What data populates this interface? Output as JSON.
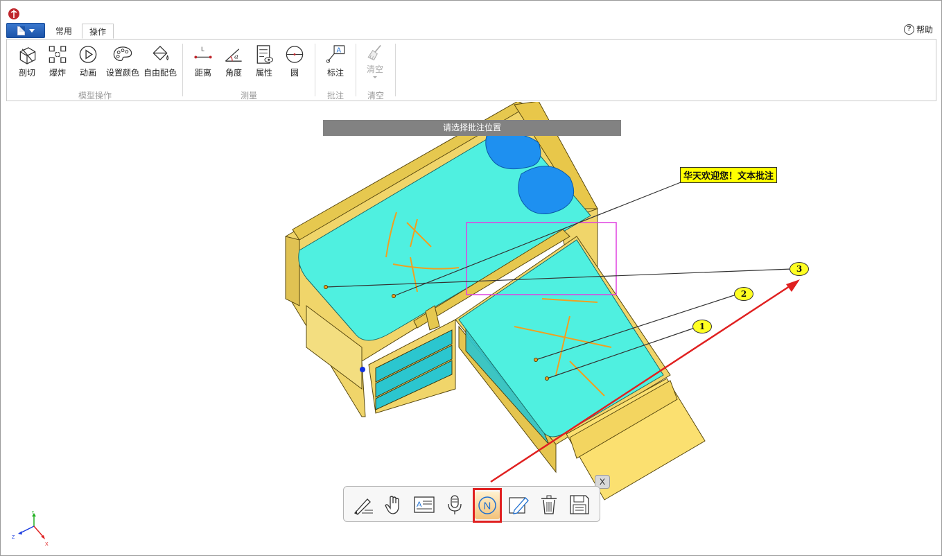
{
  "tabs": [
    {
      "label": "常用"
    },
    {
      "label": "操作"
    }
  ],
  "help": {
    "icon": "help-circle-icon",
    "label": "帮助",
    "glyph": "?"
  },
  "ribbon": {
    "groups": [
      {
        "label": "模型操作",
        "buttons": [
          {
            "label": "剖切",
            "icon": "section-cut-icon"
          },
          {
            "label": "爆炸",
            "icon": "explode-icon"
          },
          {
            "label": "动画",
            "icon": "animation-play-icon"
          },
          {
            "label": "设置颜色",
            "icon": "palette-icon"
          },
          {
            "label": "自由配色",
            "icon": "paint-bucket-icon"
          }
        ]
      },
      {
        "label": "测量",
        "buttons": [
          {
            "label": "距离",
            "icon": "distance-measure-icon",
            "glyph": "L"
          },
          {
            "label": "角度",
            "icon": "angle-measure-icon",
            "glyph": "a"
          },
          {
            "label": "属性",
            "icon": "properties-icon"
          },
          {
            "label": "圆",
            "icon": "circle-measure-icon"
          }
        ]
      },
      {
        "label": "批注",
        "buttons": [
          {
            "label": "标注",
            "icon": "annotation-label-icon",
            "glyph": "A"
          }
        ]
      },
      {
        "label": "清空",
        "buttons": [
          {
            "label": "清空",
            "icon": "broom-icon",
            "disabled": true
          }
        ]
      }
    ]
  },
  "viewport": {
    "hint": "请选择批注位置",
    "text_annotation": "华天欢迎您！文本批注",
    "balloons": [
      {
        "label": "1"
      },
      {
        "label": "2"
      },
      {
        "label": "3"
      }
    ],
    "axis_labels": {
      "y": "Y",
      "z": "Z",
      "x": "X"
    }
  },
  "annotation_toolbar": {
    "tools": [
      {
        "icon": "pen-sketch-icon"
      },
      {
        "icon": "hand-pan-icon"
      },
      {
        "icon": "text-note-icon"
      },
      {
        "icon": "microphone-icon"
      },
      {
        "icon": "numbered-balloon-icon",
        "glyph": "N",
        "active": true
      },
      {
        "icon": "edit-pencil-icon"
      },
      {
        "icon": "trash-icon"
      },
      {
        "icon": "save-disk-icon"
      }
    ],
    "close_label": "X"
  },
  "colors": {
    "mattress": "#4ff0e0",
    "frame": "#f0d56a",
    "pillow": "#1e90f0",
    "active_tool_border": "#e02020",
    "arrow": "#e02020",
    "selection_box": "#e040e0",
    "hint_bar": "#828282"
  }
}
